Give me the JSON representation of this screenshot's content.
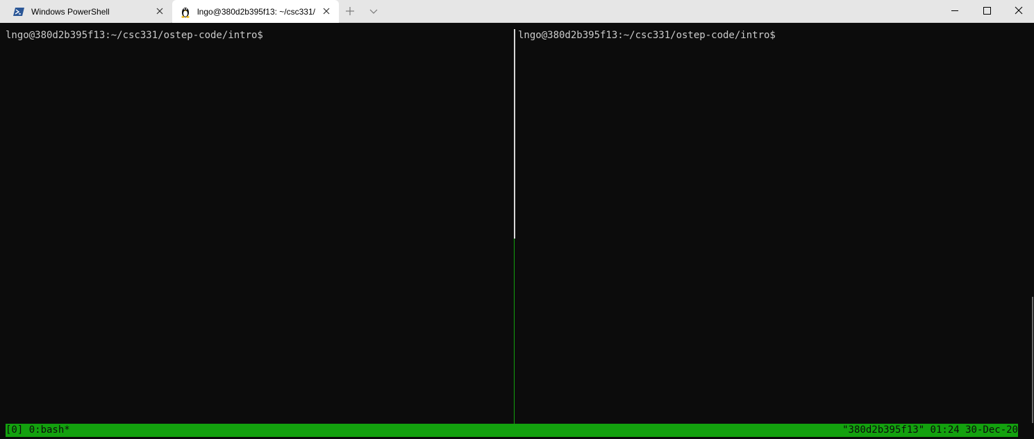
{
  "tabs": [
    {
      "label": "Windows PowerShell",
      "icon": "powershell-icon",
      "active": false
    },
    {
      "label": "lngo@380d2b395f13: ~/csc331/",
      "icon": "linux-penguin-icon",
      "active": true
    }
  ],
  "titlebar": {
    "new_tab_icon": "plus-icon",
    "dropdown_icon": "chevron-down-icon",
    "minimize_icon": "minimize-icon",
    "maximize_icon": "maximize-icon",
    "close_icon": "close-icon"
  },
  "panes": {
    "left": {
      "prompt": "lngo@380d2b395f13:~/csc331/ostep-code/intro$"
    },
    "right": {
      "prompt": "lngo@380d2b395f13:~/csc331/ostep-code/intro$"
    }
  },
  "status_bar": {
    "left": "[0] 0:bash*",
    "right": "\"380d2b395f13\" 01:24 30-Dec-20"
  },
  "colors": {
    "terminal_bg": "#0c0c0c",
    "terminal_fg": "#cccccc",
    "status_bar_bg": "#13a10e",
    "powershell_blue": "#2b5797"
  }
}
